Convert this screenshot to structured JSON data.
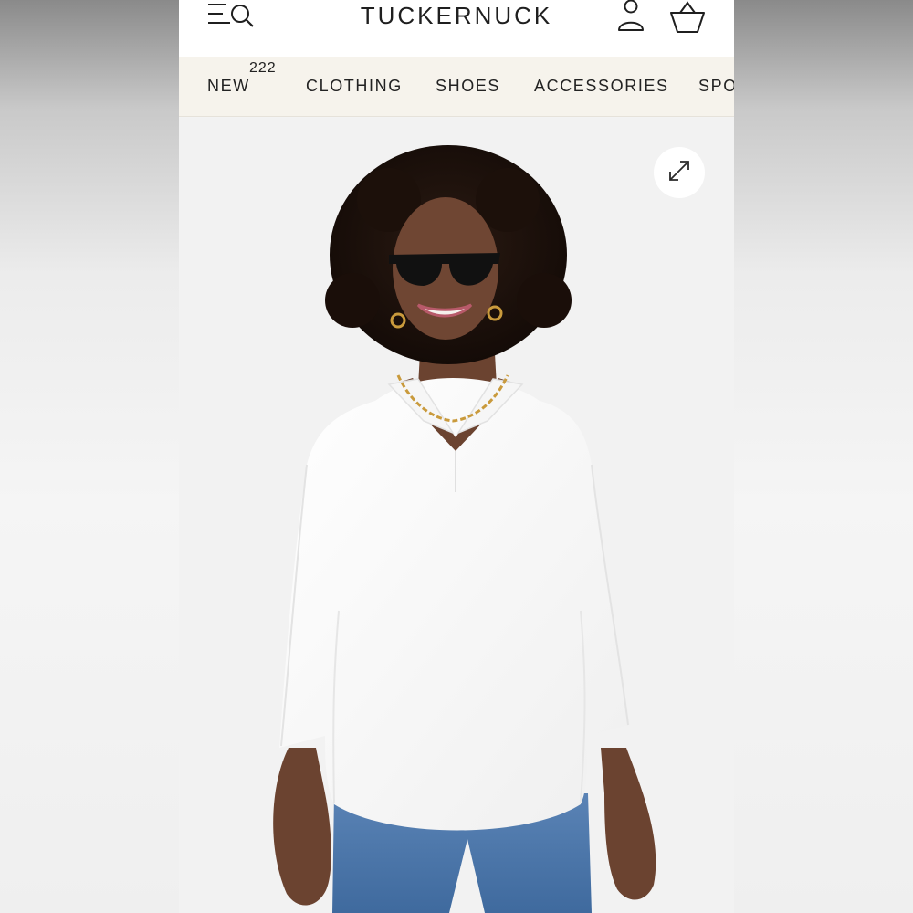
{
  "brand": {
    "name": "TUCKERNUCK"
  },
  "icons": {
    "menu": "menu-search-icon",
    "account": "account-icon",
    "bag": "shopping-bag-icon",
    "expand": "expand-icon"
  },
  "nav": {
    "items": [
      {
        "label": "NEW",
        "badge": "222"
      },
      {
        "label": "CLOTHING"
      },
      {
        "label": "SHOES"
      },
      {
        "label": "ACCESSORIES"
      },
      {
        "label": "SPO"
      }
    ]
  },
  "colors": {
    "header_bg": "#ffffff",
    "nav_bg": "#f6f3ec",
    "text": "#1f1f1f",
    "photo_bg": "#f2f2f2"
  }
}
